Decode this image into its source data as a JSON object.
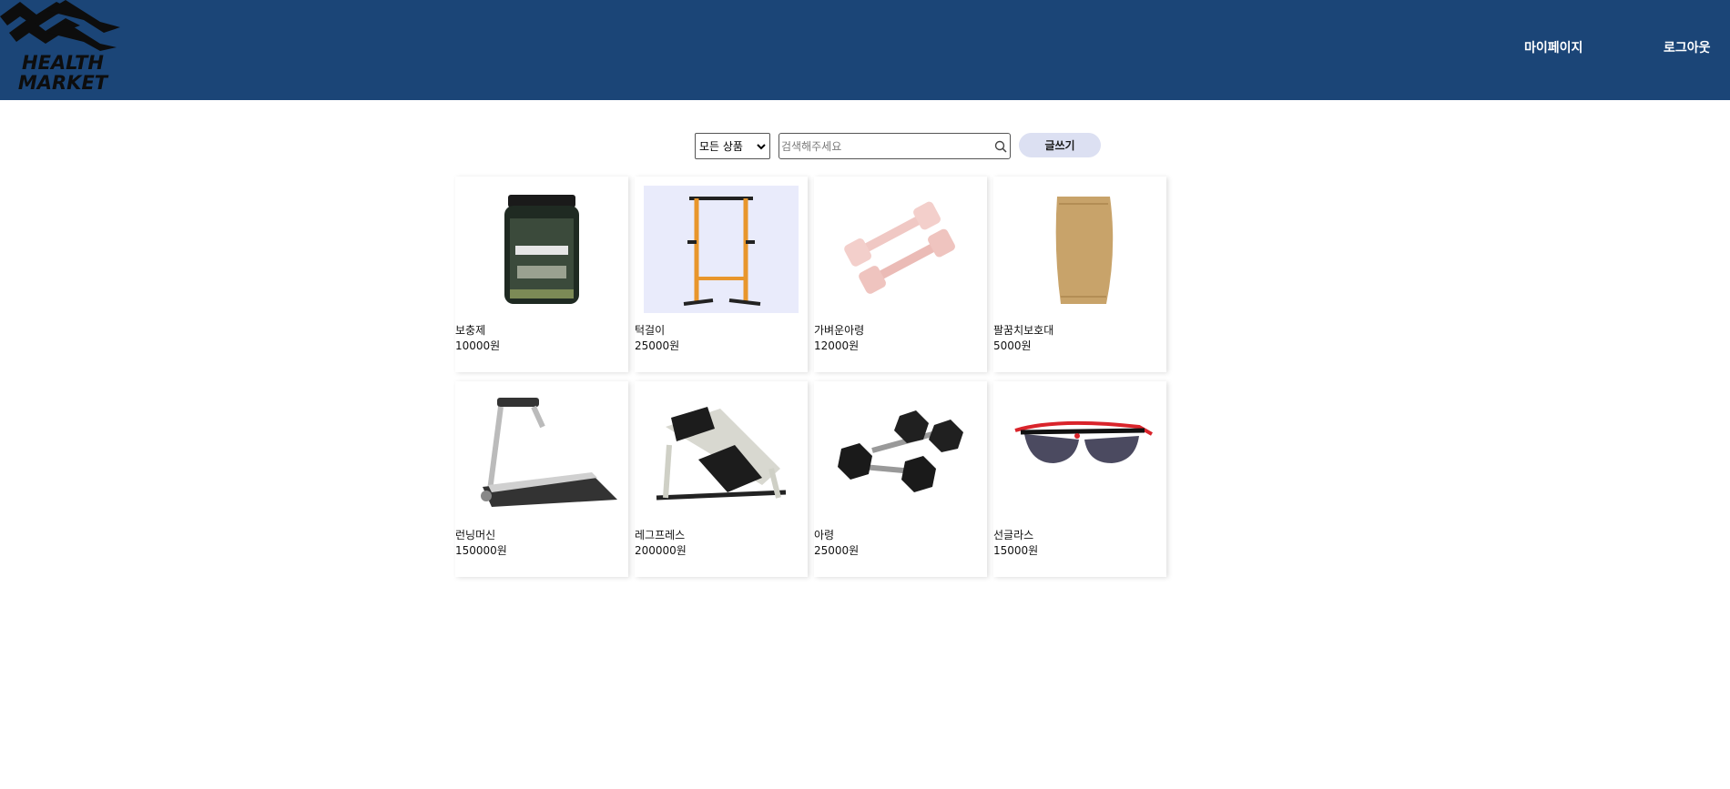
{
  "header": {
    "logo_line1": "HEALTH",
    "logo_line2": "MARKET",
    "nav": {
      "mypage": "마이페이지",
      "logout": "로그아웃"
    },
    "bg_color": "#1b4577"
  },
  "search": {
    "category_selected": "모든 상품",
    "placeholder": "검색해주세요",
    "write_button": "글쓰기"
  },
  "products": [
    {
      "name": "보충제",
      "price": "10000원",
      "icon": "protein-tub-icon"
    },
    {
      "name": "턱걸이",
      "price": "25000원",
      "icon": "pullup-tower-icon"
    },
    {
      "name": "가벼운아령",
      "price": "12000원",
      "icon": "pink-dumbbell-icon"
    },
    {
      "name": "팔꿈치보호대",
      "price": "5000원",
      "icon": "elbow-sleeve-icon"
    },
    {
      "name": "런닝머신",
      "price": "150000원",
      "icon": "treadmill-icon"
    },
    {
      "name": "레그프레스",
      "price": "200000원",
      "icon": "leg-press-icon"
    },
    {
      "name": "아령",
      "price": "25000원",
      "icon": "hex-dumbbell-icon"
    },
    {
      "name": "선글라스",
      "price": "15000원",
      "icon": "sunglasses-icon"
    }
  ]
}
